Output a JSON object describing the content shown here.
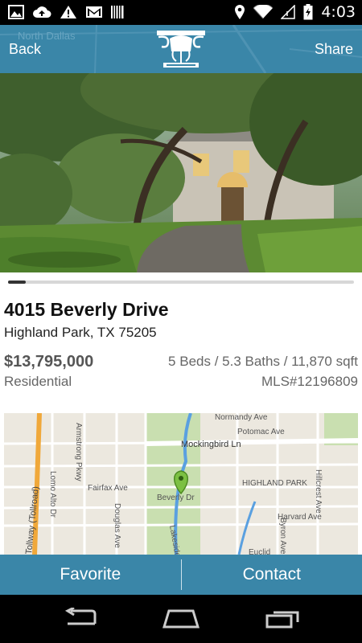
{
  "status_bar": {
    "time": "4:03",
    "icons": [
      "image-icon",
      "cloud-upload-icon",
      "warning-icon",
      "gmail-icon",
      "barcode-icon",
      "location-icon",
      "wifi-icon",
      "signal-icon",
      "battery-icon"
    ]
  },
  "header": {
    "back_label": "Back",
    "share_label": "Share",
    "map_text": "North Dallas"
  },
  "gallery": {
    "progress": 0.05
  },
  "listing": {
    "address": "4015 Beverly Drive",
    "city": "Highland Park, TX 75205",
    "price": "$13,795,000",
    "specs": "5 Beds / 5.3 Baths / 11,870 sqft",
    "type": "Residential",
    "mls": "MLS#12196809"
  },
  "map": {
    "labels": {
      "normandy": "Normandy Ave",
      "potomac": "Potomac Ave",
      "mockingbird": "Mockingbird Ln",
      "highland": "HIGHLAND PARK",
      "fairfax": "Fairfax Ave",
      "armstrong": "Armstrong Pkwy",
      "tollroad": "Tollway (Tollroad)",
      "lomo": "Lomo Alto Dr",
      "douglas": "Douglas Ave",
      "beverly": "Beverly Dr",
      "hillcrest": "Hillcrest Ave",
      "harvard": "Harvard Ave",
      "byron": "Byron Ave",
      "lakeside": "Lakeside",
      "euclid": "Euclid"
    }
  },
  "actions": {
    "favorite": "Favorite",
    "contact": "Contact"
  },
  "colors": {
    "brand": "#3a86a8"
  }
}
